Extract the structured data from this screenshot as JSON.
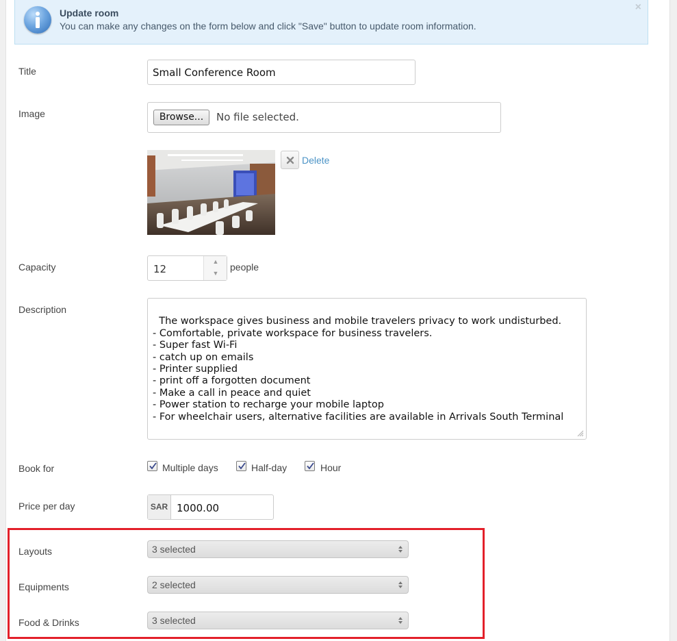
{
  "alert": {
    "title": "Update room",
    "message": "You can make any changes on the form below and click \"Save\" button to update room information.",
    "close": "×"
  },
  "form": {
    "title_label": "Title",
    "title_value": "Small Conference Room",
    "image_label": "Image",
    "browse_label": "Browse...",
    "no_file_text": "No file selected.",
    "delete_label": "Delete",
    "capacity_label": "Capacity",
    "capacity_value": "12",
    "capacity_unit": "people",
    "description_label": "Description",
    "description_value": "The workspace gives business and mobile travelers privacy to work undisturbed.\n- Comfortable, private workspace for business travelers.\n- Super fast Wi-Fi\n- catch up on emails\n- Printer supplied\n- print off a forgotten document\n- Make a call in peace and quiet\n- Power station to recharge your mobile laptop\n- For wheelchair users, alternative facilities are available in Arrivals South Terminal",
    "book_for_label": "Book for",
    "book_options": [
      {
        "label": "Multiple days",
        "checked": true
      },
      {
        "label": "Half-day",
        "checked": true
      },
      {
        "label": "Hour",
        "checked": true
      }
    ],
    "price_label": "Price per day",
    "currency": "SAR",
    "price_value": "1000.00",
    "layouts_label": "Layouts",
    "layouts_value": "3 selected",
    "equipments_label": "Equipments",
    "equipments_value": "2 selected",
    "food_label": "Food & Drinks",
    "food_value": "3 selected"
  },
  "colors": {
    "alert_bg": "#e4f1fb",
    "link": "#4b93c6",
    "highlight_border": "#e3202a"
  },
  "icons": {
    "alert": "info-icon",
    "close": "close-icon",
    "delete": "x-icon",
    "checkbox": "check-icon",
    "select": "updown-caret-icon"
  }
}
